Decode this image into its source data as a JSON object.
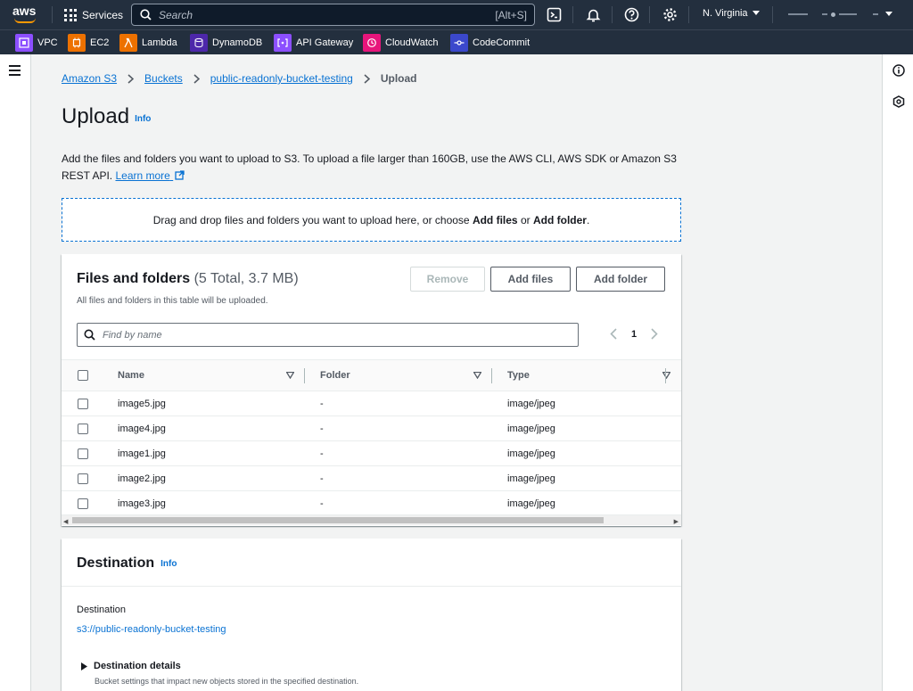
{
  "topnav": {
    "logo_text": "aws",
    "services_label": "Services",
    "search_placeholder": "Search",
    "search_shortcut": "[Alt+S]",
    "region": "N. Virginia"
  },
  "favorites": [
    {
      "label": "VPC",
      "color": "#8c4fff"
    },
    {
      "label": "EC2",
      "color": "#ed7100"
    },
    {
      "label": "Lambda",
      "color": "#ed7100"
    },
    {
      "label": "DynamoDB",
      "color": "#4d27aa"
    },
    {
      "label": "API Gateway",
      "color": "#8c4fff"
    },
    {
      "label": "CloudWatch",
      "color": "#e7157b"
    },
    {
      "label": "CodeCommit",
      "color": "#3b48cc"
    }
  ],
  "breadcrumb": {
    "items": [
      "Amazon S3",
      "Buckets",
      "public-readonly-bucket-testing"
    ],
    "current": "Upload"
  },
  "page": {
    "title": "Upload",
    "info": "Info",
    "description": "Add the files and folders you want to upload to S3. To upload a file larger than 160GB, use the AWS CLI, AWS SDK or Amazon S3 REST API.",
    "learn_more": "Learn more"
  },
  "dropzone": {
    "text_before": "Drag and drop files and folders you want to upload here, or choose ",
    "add_files": "Add files",
    "middle": " or ",
    "add_folder": "Add folder",
    "end": "."
  },
  "files_panel": {
    "title": "Files and folders",
    "count": "(5 Total, 3.7 MB)",
    "subtitle": "All files and folders in this table will be uploaded.",
    "remove_label": "Remove",
    "add_files_label": "Add files",
    "add_folder_label": "Add folder",
    "filter_placeholder": "Find by name",
    "page_number": "1",
    "columns": [
      "Name",
      "Folder",
      "Type"
    ],
    "rows": [
      {
        "name": "image5.jpg",
        "folder": "-",
        "type": "image/jpeg"
      },
      {
        "name": "image4.jpg",
        "folder": "-",
        "type": "image/jpeg"
      },
      {
        "name": "image1.jpg",
        "folder": "-",
        "type": "image/jpeg"
      },
      {
        "name": "image2.jpg",
        "folder": "-",
        "type": "image/jpeg"
      },
      {
        "name": "image3.jpg",
        "folder": "-",
        "type": "image/jpeg"
      }
    ]
  },
  "destination": {
    "title": "Destination",
    "info": "Info",
    "label": "Destination",
    "uri": "s3://public-readonly-bucket-testing",
    "details_label": "Destination details",
    "details_desc": "Bucket settings that impact new objects stored in the specified destination."
  },
  "colors": {
    "nav_bg": "#232f3e",
    "link": "#0972d3",
    "accent": "#ff9900"
  }
}
